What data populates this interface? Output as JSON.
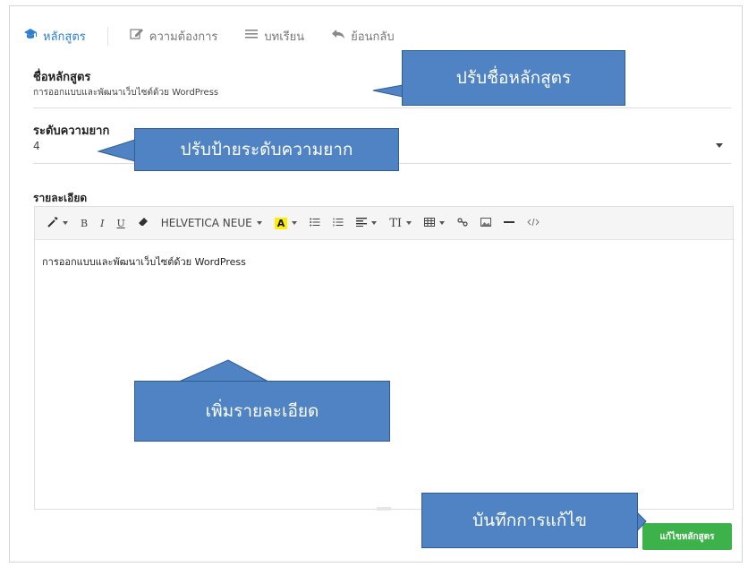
{
  "tabs": [
    {
      "label": "หลักสูตร",
      "icon": "graduation-cap-icon",
      "active": true
    },
    {
      "label": "ความต้องการ",
      "icon": "edit-icon"
    },
    {
      "label": "บทเรียน",
      "icon": "list-icon"
    },
    {
      "label": "ย้อนกลับ",
      "icon": "reply-icon"
    }
  ],
  "course_name": {
    "label": "ชื่อหลักสูตร",
    "value": "การออกแบบและพัฒนาเว็บไซต์ด้วย WordPress"
  },
  "difficulty": {
    "label": "ระดับความยาก",
    "value": "4"
  },
  "details": {
    "label": "รายละเอียด",
    "content": "การออกแบบและพัฒนาเว็บไซต์ด้วย WordPress"
  },
  "toolbar": {
    "font_name": "HELVETICA NEUE",
    "bold": "B",
    "italic": "I",
    "underline": "U",
    "font_color_letter": "A",
    "text_size": "TI"
  },
  "save_button_label": "แก้ไขหลักสูตร",
  "callouts": {
    "rename": "ปรับชื่อหลักสูตร",
    "difficulty": "ปรับป้ายระดับความยาก",
    "details": "เพิ่มรายละเอียด",
    "save": "บันทึกการแก้ไข"
  },
  "colors": {
    "accent": "#2f80d1",
    "callout": "#4f83c4",
    "save": "#3db24a",
    "highlight": "#ffee00"
  }
}
